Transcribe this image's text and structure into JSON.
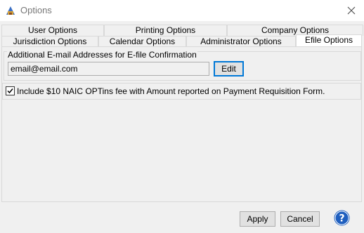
{
  "window": {
    "title": "Options",
    "app_icon": "options-app-icon",
    "close_icon": "close-icon"
  },
  "tabs": {
    "row_back": [
      "User Options",
      "Printing Options",
      "Company Options"
    ],
    "row_front": [
      "Jurisdiction Options",
      "Calendar Options",
      "Administrator Options",
      "Efile Options"
    ],
    "active": "Efile Options"
  },
  "efile": {
    "group_label": "Additional E-mail Addresses for E-file Confirmation",
    "email_value": "email@email.com",
    "edit_label": "Edit",
    "naic_checkbox_label": "Include $10 NAIC OPTins fee with Amount reported on Payment Requisition Form.",
    "naic_checked": true
  },
  "footer": {
    "apply_label": "Apply",
    "cancel_label": "Cancel",
    "help_icon": "help-icon"
  },
  "colors": {
    "accent": "#0078d7",
    "help_blue": "#1f5fbf",
    "window_bg": "#f0f0f0"
  }
}
